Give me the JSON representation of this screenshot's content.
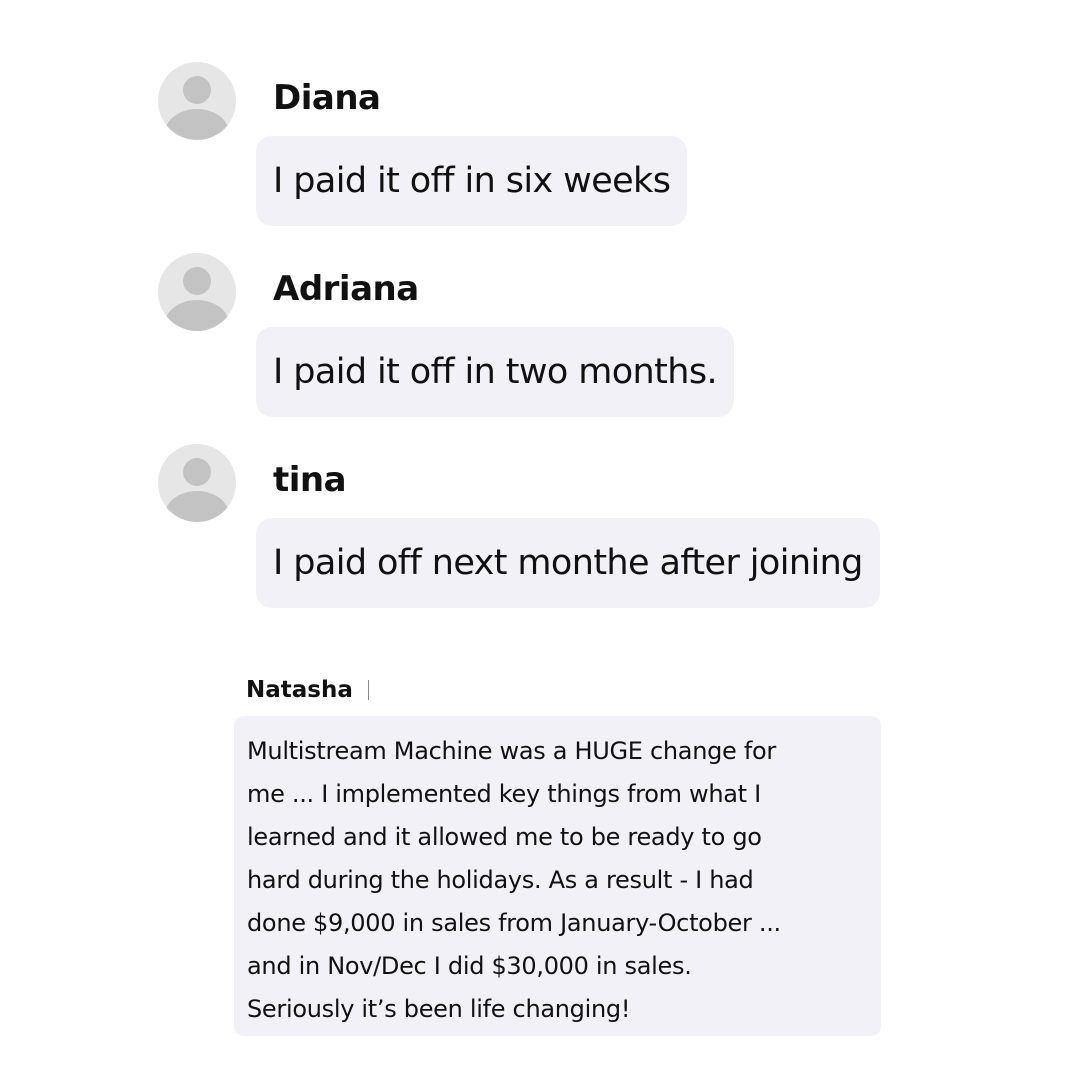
{
  "chat": {
    "messages": [
      {
        "sender": "Diana",
        "text": "I paid it off in six weeks",
        "avatar_icon": "user-placeholder-icon"
      },
      {
        "sender": "Adriana",
        "text": "I paid it off in two months.",
        "avatar_icon": "user-placeholder-icon"
      },
      {
        "sender": "tina",
        "text": "I paid off next monthe after joining",
        "avatar_icon": "user-placeholder-icon"
      }
    ]
  },
  "testimonial": {
    "sender": "Natasha",
    "lines": [
      "Multistream Machine was a HUGE change for",
      "me ... I implemented key things from what I",
      "learned and it allowed me to be ready to go",
      "hard during the holidays. As a result - I had",
      "done $9,000 in sales from January-October ...",
      "and in Nov/Dec I did $30,000 in sales.",
      "Seriously it’s been life changing!"
    ]
  },
  "colors": {
    "bubble_background": "#f2f1f7",
    "avatar_background": "#e6e6e6",
    "avatar_figure": "#c3c3c3",
    "text": "#111111"
  }
}
